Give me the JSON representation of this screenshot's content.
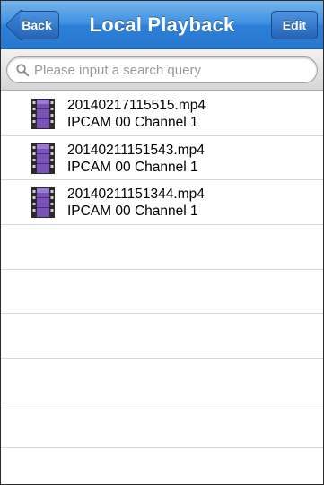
{
  "navbar": {
    "title": "Local Playback",
    "back_label": "Back",
    "edit_label": "Edit"
  },
  "search": {
    "placeholder": "Please input a search query",
    "value": ""
  },
  "recordings": [
    {
      "file": "20140217115515.mp4",
      "channel": "IPCAM 00 Channel 1",
      "icon": "film-icon"
    },
    {
      "file": "20140211151543.mp4",
      "channel": "IPCAM 00 Channel 1",
      "icon": "film-icon"
    },
    {
      "file": "20140211151344.mp4",
      "channel": "IPCAM 00 Channel 1",
      "icon": "film-icon"
    }
  ],
  "colors": {
    "navbar": "#3e8fe0",
    "film_purple": "#7a52b8"
  }
}
